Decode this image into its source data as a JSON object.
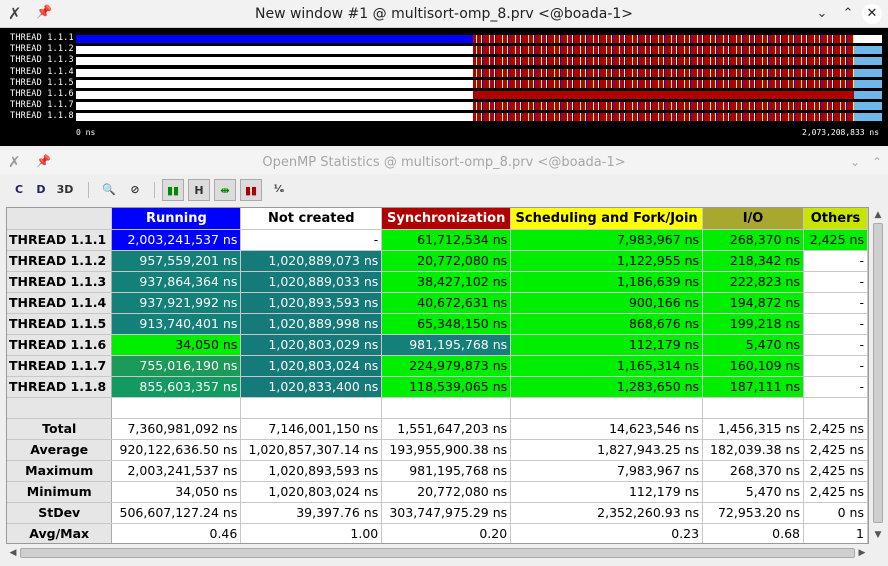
{
  "timeline_window": {
    "title": "New window #1 @ multisort-omp_8.prv <@boada-1>",
    "threads": [
      "THREAD 1.1.1",
      "THREAD 1.1.2",
      "THREAD 1.1.3",
      "THREAD 1.1.4",
      "THREAD 1.1.5",
      "THREAD 1.1.6",
      "THREAD 1.1.7",
      "THREAD 1.1.8"
    ],
    "axis_start": "0 ns",
    "axis_end": "2,073,208,833 ns",
    "colors": {
      "running": "#0000ff",
      "not_created": "#ffffff",
      "synchronization": "#b00000",
      "scheduling": "#ffff00",
      "io": "#6fb6ea",
      "others_purple": "#8000a0"
    }
  },
  "stats_window": {
    "title": "OpenMP Statistics @ multisort-omp_8.prv <@boada-1>",
    "toolbar": {
      "buttons": [
        "C",
        "D",
        "3D",
        "find",
        "filter",
        "color",
        "H",
        "hide",
        "semantic",
        "1/E"
      ]
    },
    "columns": [
      {
        "label": "Running",
        "bg": "#0000ff",
        "fg": "#ffffff"
      },
      {
        "label": "Not created",
        "bg": "#ffffff",
        "fg": "#000000"
      },
      {
        "label": "Synchronization",
        "bg": "#b00000",
        "fg": "#ffffff"
      },
      {
        "label": "Scheduling and Fork/Join",
        "bg": "#ffff00",
        "fg": "#000000"
      },
      {
        "label": "I/O",
        "bg": "#a8a830",
        "fg": "#000000"
      },
      {
        "label": "Others",
        "bg": "#c8e400",
        "fg": "#000000"
      }
    ],
    "rows": [
      {
        "label": "THREAD 1.1.1",
        "cells": [
          "2,003,241,537 ns",
          "-",
          "61,712,534 ns",
          "7,983,967 ns",
          "268,370 ns",
          "2,425 ns"
        ]
      },
      {
        "label": "THREAD 1.1.2",
        "cells": [
          "957,559,201 ns",
          "1,020,889,073 ns",
          "20,772,080 ns",
          "1,122,955 ns",
          "218,342 ns",
          "-"
        ]
      },
      {
        "label": "THREAD 1.1.3",
        "cells": [
          "937,864,364 ns",
          "1,020,889,033 ns",
          "38,427,102 ns",
          "1,186,639 ns",
          "222,823 ns",
          "-"
        ]
      },
      {
        "label": "THREAD 1.1.4",
        "cells": [
          "937,921,992 ns",
          "1,020,893,593 ns",
          "40,672,631 ns",
          "900,166 ns",
          "194,872 ns",
          "-"
        ]
      },
      {
        "label": "THREAD 1.1.5",
        "cells": [
          "913,740,401 ns",
          "1,020,889,998 ns",
          "65,348,150 ns",
          "868,676 ns",
          "199,218 ns",
          "-"
        ]
      },
      {
        "label": "THREAD 1.1.6",
        "cells": [
          "34,050 ns",
          "1,020,803,029 ns",
          "981,195,768 ns",
          "112,179 ns",
          "5,470 ns",
          "-"
        ]
      },
      {
        "label": "THREAD 1.1.7",
        "cells": [
          "755,016,190 ns",
          "1,020,803,024 ns",
          "224,979,873 ns",
          "1,165,314 ns",
          "160,109 ns",
          "-"
        ]
      },
      {
        "label": "THREAD 1.1.8",
        "cells": [
          "855,603,357 ns",
          "1,020,833,400 ns",
          "118,539,065 ns",
          "1,283,650 ns",
          "187,111 ns",
          "-"
        ]
      }
    ],
    "cell_colors": [
      [
        "#0000ff",
        "#ffffff",
        "#00ee00",
        "#00ee00",
        "#00ee00",
        "#00ee00"
      ],
      [
        "#14807a",
        "#147a7a",
        "#00ee00",
        "#00ee00",
        "#00ee00",
        "#ffffff"
      ],
      [
        "#14807a",
        "#147a7a",
        "#00ee00",
        "#00ee00",
        "#00ee00",
        "#ffffff"
      ],
      [
        "#14807a",
        "#147a7a",
        "#00ee00",
        "#00ee00",
        "#00ee00",
        "#ffffff"
      ],
      [
        "#14807a",
        "#147a7a",
        "#00ee00",
        "#00ee00",
        "#00ee00",
        "#ffffff"
      ],
      [
        "#00ee00",
        "#147a7a",
        "#14807a",
        "#00ee00",
        "#00ee00",
        "#ffffff"
      ],
      [
        "#1c9a5a",
        "#147a7a",
        "#00ee00",
        "#00ee00",
        "#00ee00",
        "#ffffff"
      ],
      [
        "#129a60",
        "#147a7a",
        "#00ee00",
        "#00ee00",
        "#00ee00",
        "#ffffff"
      ]
    ],
    "summary": [
      {
        "label": "Total",
        "cells": [
          "7,360,981,092 ns",
          "7,146,001,150 ns",
          "1,551,647,203 ns",
          "14,623,546 ns",
          "1,456,315 ns",
          "2,425 ns"
        ]
      },
      {
        "label": "Average",
        "cells": [
          "920,122,636.50 ns",
          "1,020,857,307.14 ns",
          "193,955,900.38 ns",
          "1,827,943.25 ns",
          "182,039.38 ns",
          "2,425 ns"
        ]
      },
      {
        "label": "Maximum",
        "cells": [
          "2,003,241,537 ns",
          "1,020,893,593 ns",
          "981,195,768 ns",
          "7,983,967 ns",
          "268,370 ns",
          "2,425 ns"
        ]
      },
      {
        "label": "Minimum",
        "cells": [
          "34,050 ns",
          "1,020,803,024 ns",
          "20,772,080 ns",
          "112,179 ns",
          "5,470 ns",
          "2,425 ns"
        ]
      },
      {
        "label": "StDev",
        "cells": [
          "506,607,127.24 ns",
          "39,397.76 ns",
          "303,747,975.29 ns",
          "2,352,260.93 ns",
          "72,953.20 ns",
          "0 ns"
        ]
      },
      {
        "label": "Avg/Max",
        "cells": [
          "0.46",
          "1.00",
          "0.20",
          "0.23",
          "0.68",
          "1"
        ]
      }
    ]
  }
}
